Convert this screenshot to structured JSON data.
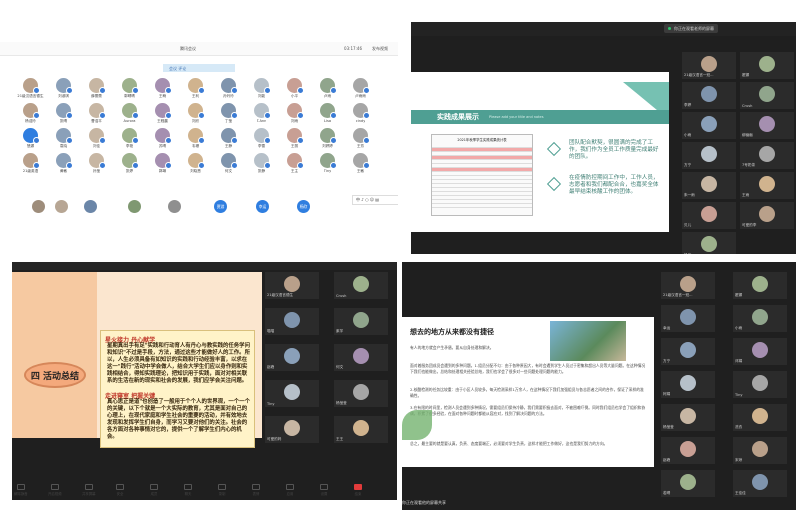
{
  "panel1": {
    "window_title": "腾讯会议",
    "top_right": [
      "03:17:46",
      "发布视频"
    ],
    "search_chip": "会议 评论",
    "attendees": [
      {
        "name": "21级汉语言德生"
      },
      {
        "name": "刘淑琪"
      },
      {
        "name": "薛蕾蕾"
      },
      {
        "name": "郭晴晴"
      },
      {
        "name": "王萌"
      },
      {
        "name": "王利"
      },
      {
        "name": "孙玲玲"
      },
      {
        "name": "刘能"
      },
      {
        "name": "小平"
      },
      {
        "name": "卢雨"
      },
      {
        "name": "卢雨雨"
      },
      {
        "name": "杨迎玲"
      },
      {
        "name": "张晴"
      },
      {
        "name": "曹浩平"
      },
      {
        "name": "Aurora"
      },
      {
        "name": "王程晨"
      },
      {
        "name": "刘欣"
      },
      {
        "name": "丁莹"
      },
      {
        "name": "T.Ann"
      },
      {
        "name": "刘雨"
      },
      {
        "name": "Lisa"
      },
      {
        "name": "cindy"
      },
      {
        "name": "慧娜",
        "blue": true
      },
      {
        "name": "袁晓"
      },
      {
        "name": "刘佳"
      },
      {
        "name": "李艳"
      },
      {
        "name": "苏晴"
      },
      {
        "name": "韦珊"
      },
      {
        "name": "王静"
      },
      {
        "name": "李雪"
      },
      {
        "name": "王丽"
      },
      {
        "name": "刘婷婷"
      },
      {
        "name": "王芳"
      },
      {
        "name": "21级英语"
      },
      {
        "name": "黄敏"
      },
      {
        "name": "孙莹"
      },
      {
        "name": "张婷"
      },
      {
        "name": "郭琳"
      },
      {
        "name": "刘晓慧"
      },
      {
        "name": "何文"
      },
      {
        "name": "张静"
      },
      {
        "name": "王主"
      },
      {
        "name": "Tiny"
      },
      {
        "name": "王敏"
      }
    ],
    "bottom_buttons": [
      "贾游",
      "幸运",
      "杨欣"
    ],
    "toolbar_label": "中 ♪ ○ ☺ ▤"
  },
  "panel2": {
    "badge": "你正在观看老师的屏幕",
    "slide_title": "实践成果展示",
    "slide_subtitle": "Please add your title and notes",
    "point1": "团队配合默契，很圆满的完成了工作，我们作为全员工作质量完成最好的团队。",
    "point2": "在疫情防控期间工作中，工作人员，志愿者和我们都配合合，也嘉奖全体最早结束核酸工作的团体。",
    "sheet_title": "2021年秋季学生实践成果统计表",
    "participants": [
      "21级汉语言一班...",
      "翟娜",
      "李婷",
      "Crush",
      "小雨",
      "柳幽幽",
      "方宁",
      "7号奶茶",
      "朱一雨",
      "王雨",
      "贝儿",
      "可爱的李",
      "杨欣"
    ]
  },
  "panel3": {
    "slide_title": "四 活动总结",
    "heading1": "星火接力 丹心献学",
    "body1": "星期真出手有足\"实践和行动育人有丹心与教实践的任务学问和知识\"不过是手段，方法，通过这些才能做好人的工作。所以，人生必须具备有如知识的实践和行动经验丰富，以求在这一\"践行\"活动中学会做人，结合大学生们应以身作则和实践相结合，得知实践理论，把知识用于实践，面对对相关联系的生活在新的现实和社会的发展，我们应学会关注问题。",
    "heading2": "走进寝室 把握关键",
    "body2": "真心思正是道\"也创造了一般用于个个人的世界观，一个一个的关键，以下个就是一个大实际的教育，尤其是面对自己的心理上，在现代家庭和学生社会的重要的活动，并有效地去发现和发挥学生们自身，而学习又要对他们的关注。社会的各方面对各种事情对它的，提供一个了解学生们内心的机会。",
    "participants": [
      "21级汉语言德生",
      "Crush",
      "喵喵",
      "紫芋",
      "赵峰",
      "何文",
      "Tiny",
      "杨莹莹",
      "可爱的妈",
      "王王"
    ]
  },
  "panel4": {
    "slide_title": "想去的地方从来都没有捷径",
    "para1": "有人的地方就会产生矛盾，要从自身处理和解决。",
    "para2": "面对着服务团成员会遇到的多种问题。1.组员分配不匀：由于各种原因大，有时会遇到学生人员过于密集和超出人员等大量问题。在这种情况下我们也能做出，总结和处理相关经验总结，我们也学会了很多对一些问题处理问题的能力。",
    "para3": "2.核酸检测的任务比较重：由于小区人员较多，每天检测采样1万余人，在这种情况下我们加强组员与各志愿者之间的合作，保证了采样的准确性。",
    "para4": "3.在有限的时间里，检测人员会遇到多种情况，需要组员们保持冷静，我们需要积极去面对，不被困难吓倒。同时我们组员也学会了组织和协调，积累了很多经验，在面对各种问题时都能从容应对，找到了解决问题的方法。",
    "para5": "总之，最主要的就是要认真，负责、态度要端正，必须要对学生负责，这样才能把工作做好，这也是我们努力的方向。",
    "footer": "你正在观看他的屏幕共享",
    "participants": [
      "21级汉语言一班...",
      "翟娜",
      "幸运",
      "小雨",
      "方宁",
      "邓娟",
      "柯娟",
      "Tiny",
      "杨莹莹",
      "洗衣",
      "赵峰",
      "宋琼",
      "若晴",
      "王佳佳"
    ]
  },
  "toolbar": {
    "items": [
      "解除静音",
      "开启视频",
      "共享屏幕",
      "安全",
      "成员",
      "聊天",
      "录制",
      "表情",
      "应用",
      "设置",
      "结束"
    ]
  }
}
